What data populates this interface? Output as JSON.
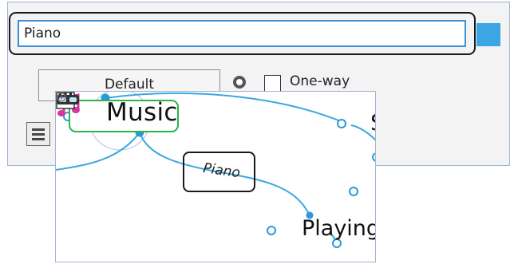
{
  "editor": {
    "label_value": "Piano",
    "color_swatch": "#3ba6e3",
    "style_button_label": "Default",
    "oneway_label": "One-way",
    "oneway_checked": false
  },
  "mindmap": {
    "nodes": {
      "music": "Music",
      "playing": "Playing"
    },
    "link_label": "Piano",
    "partial_node_text": "S"
  },
  "colors": {
    "accent": "#3ba6e3",
    "node_border": "#2db34a",
    "link": "#3ba6e3",
    "callout": "#1a1a1a"
  },
  "icons": [
    "music-note-icon",
    "piano-keys-icon",
    "goggles-icon",
    "hamburger-menu-icon",
    "zoom-icon"
  ]
}
